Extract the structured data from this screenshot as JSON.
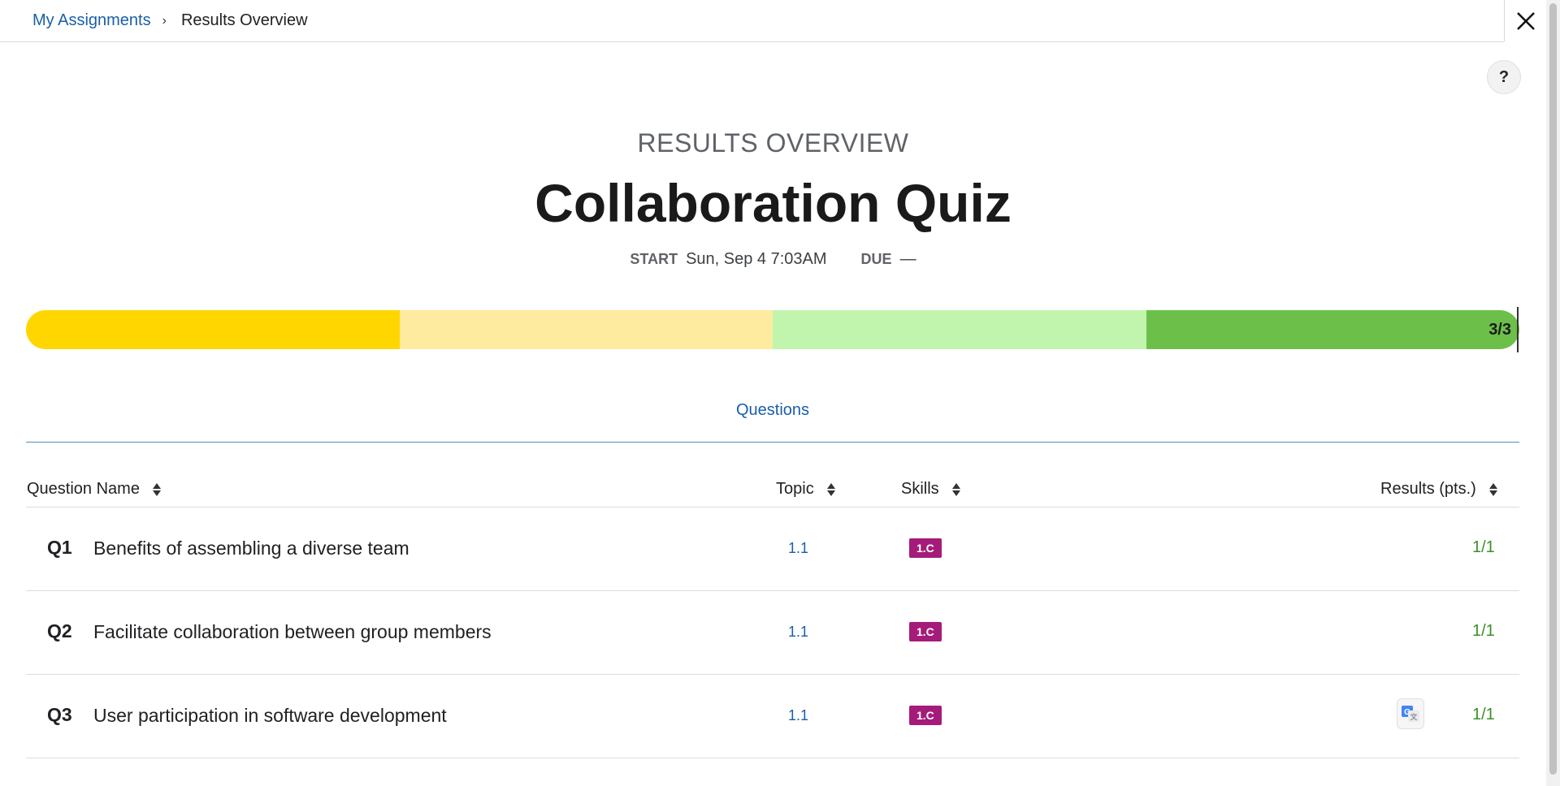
{
  "breadcrumb": {
    "parent": "My Assignments",
    "separator": "›",
    "current": "Results Overview"
  },
  "header": {
    "eyebrow": "RESULTS OVERVIEW",
    "title": "Collaboration Quiz"
  },
  "meta": {
    "start_label": "START",
    "start_value": "Sun, Sep 4 7:03AM",
    "due_label": "DUE",
    "due_value": "—"
  },
  "progress": {
    "label": "3/3",
    "score": 3,
    "total": 3
  },
  "tabs": [
    {
      "label": "Questions"
    }
  ],
  "table": {
    "columns": {
      "question_name": "Question Name",
      "topic": "Topic",
      "skills": "Skills",
      "results": "Results (pts.)"
    },
    "rows": [
      {
        "num": "Q1",
        "name": "Benefits of assembling a diverse team",
        "topic": "1.1",
        "skill": "1.C",
        "result": "1/1"
      },
      {
        "num": "Q2",
        "name": "Facilitate collaboration between group members",
        "topic": "1.1",
        "skill": "1.C",
        "result": "1/1"
      },
      {
        "num": "Q3",
        "name": "User participation in software development",
        "topic": "1.1",
        "skill": "1.C",
        "result": "1/1"
      }
    ]
  },
  "icons": {
    "close": "close-icon",
    "help": "?",
    "translate": "translate-icon"
  },
  "colors": {
    "link": "#1a5fa8",
    "skill_badge": "#a51b7a",
    "result": "#3e8e2a",
    "progress": [
      "#ffd600",
      "#feeb9f",
      "#c1f5ad",
      "#6cc04a"
    ]
  }
}
